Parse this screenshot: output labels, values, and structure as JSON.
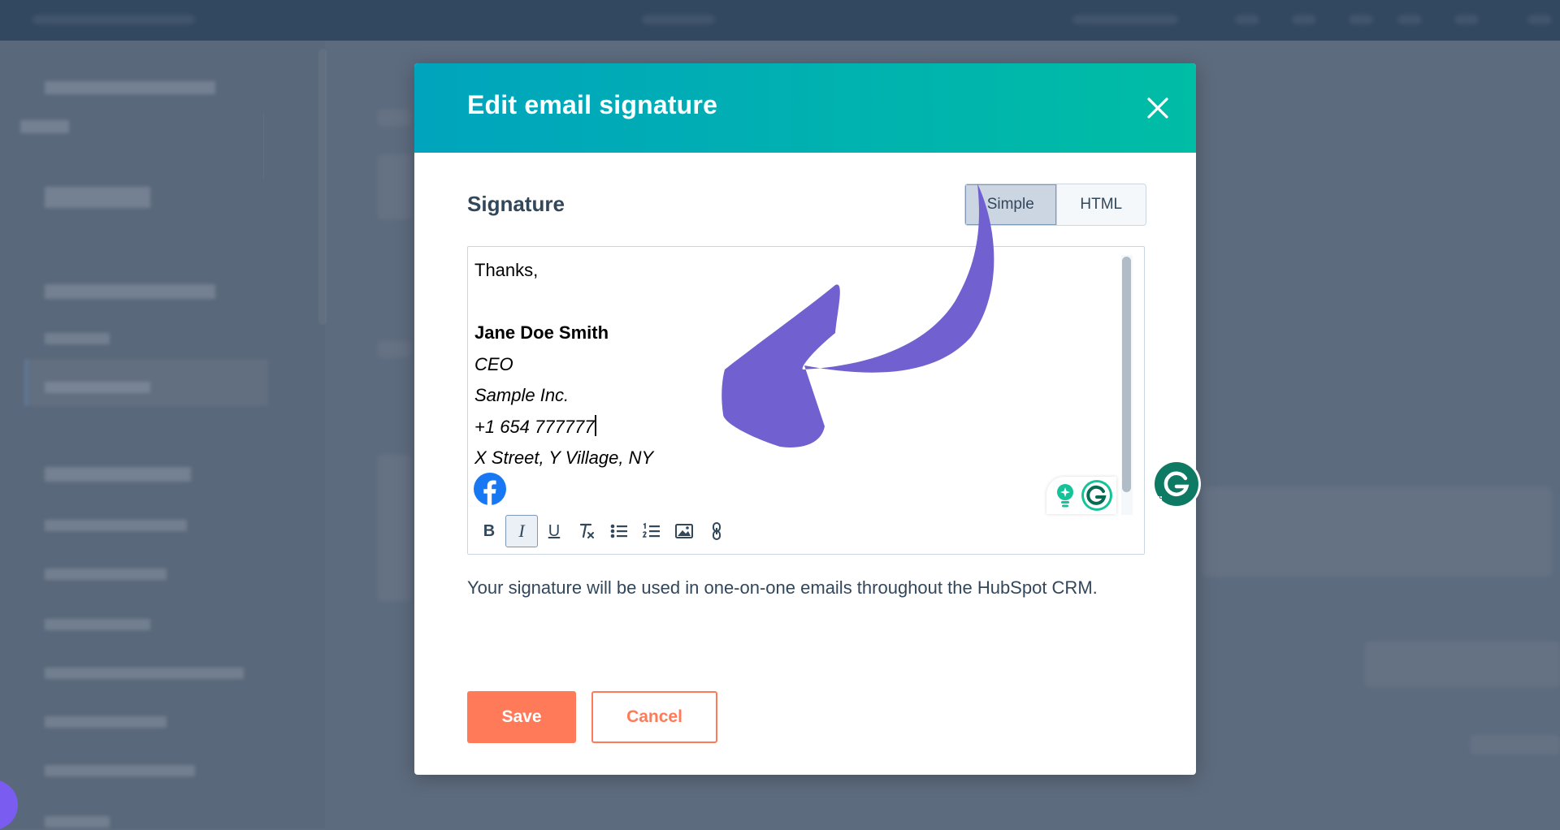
{
  "modal": {
    "title": "Edit email signature",
    "signature_heading": "Signature",
    "toggle": {
      "simple": "Simple",
      "html": "HTML",
      "selected": "Simple"
    },
    "signature_lines": {
      "greeting": "Thanks,",
      "name": "Jane Doe Smith",
      "job_title": "CEO",
      "company": "Sample Inc.",
      "phone": "+1 654 777777",
      "address": "X Street, Y Village, NY"
    },
    "toolbar": {
      "bold": "B",
      "italic": "I",
      "underline": "U",
      "clear_format": "T",
      "active_tool": "italic"
    },
    "help_text": "Your signature will be used in one-on-one emails throughout the HubSpot CRM.",
    "save_label": "Save",
    "cancel_label": "Cancel"
  },
  "colors": {
    "header_gradient_start": "#00a4bd",
    "header_gradient_end": "#00bda5",
    "primary_button": "#ff7a59",
    "text": "#33475b",
    "arrow": "#7060d0",
    "grammarly": "#15c39a",
    "facebook": "#1877f2"
  },
  "icons": {
    "close": "close-icon",
    "facebook": "facebook-icon",
    "grammarly": "grammarly-icon",
    "annotation": "curved-arrow-icon"
  }
}
